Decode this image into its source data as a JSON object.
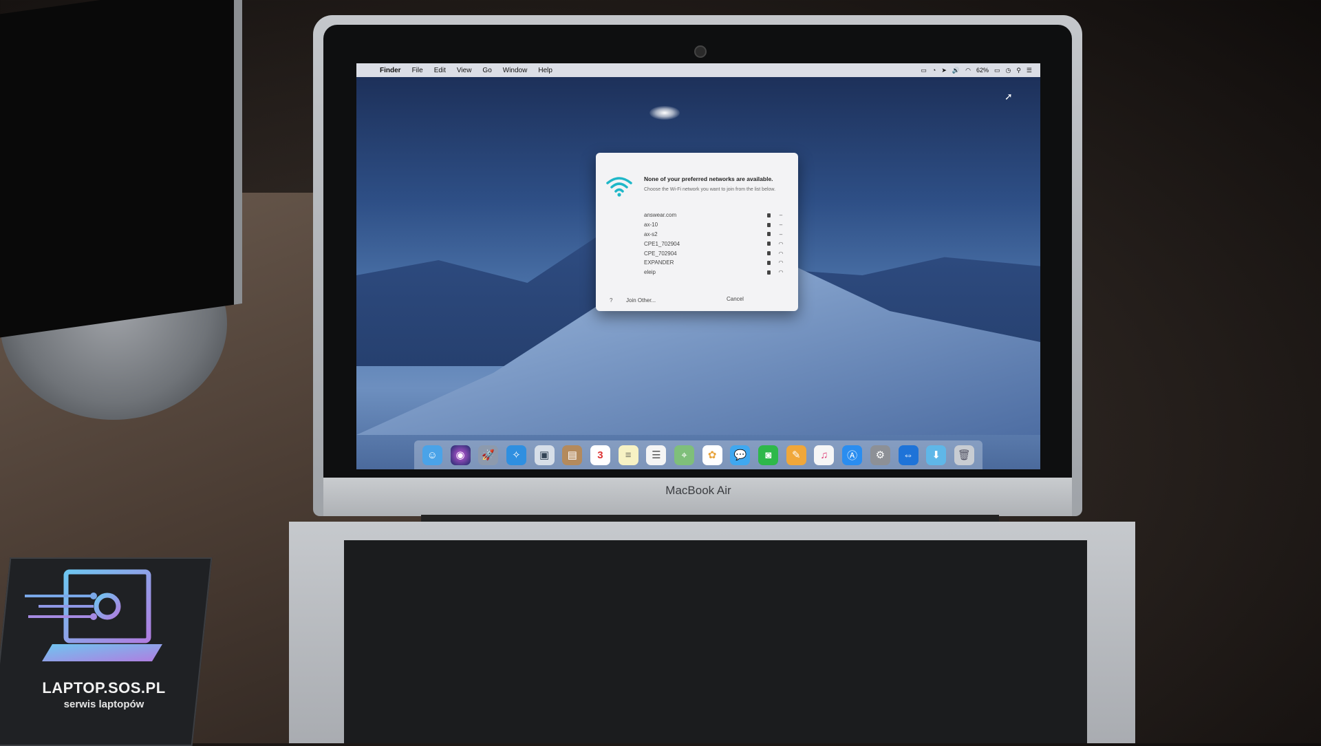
{
  "menubar": {
    "app_name": "Finder",
    "items": [
      "File",
      "Edit",
      "View",
      "Go",
      "Window",
      "Help"
    ],
    "battery_percent": "62%"
  },
  "dialog": {
    "title": "None of your preferred networks are available.",
    "subtitle": "Choose the Wi-Fi network you want to join from the list below.",
    "networks": [
      {
        "name": "answear.com",
        "locked": true,
        "signal": "weak"
      },
      {
        "name": "ax-10",
        "locked": true,
        "signal": "weak"
      },
      {
        "name": "ax-s2",
        "locked": true,
        "signal": "weak"
      },
      {
        "name": "CPE1_702904",
        "locked": true,
        "signal": "strong"
      },
      {
        "name": "CPE_702904",
        "locked": true,
        "signal": "strong"
      },
      {
        "name": "EXPANDER",
        "locked": true,
        "signal": "strong"
      },
      {
        "name": "eleip",
        "locked": true,
        "signal": "strong"
      }
    ],
    "help_label": "?",
    "join_other_label": "Join Other...",
    "cancel_label": "Cancel",
    "icon_color": "#1fb7c8"
  },
  "dock": {
    "icons": [
      "finder-icon",
      "siri-icon",
      "launchpad-icon",
      "safari-icon",
      "preview-icon",
      "contacts-icon",
      "calendar-icon",
      "notes-icon",
      "reminders-icon",
      "maps-icon",
      "photos-icon",
      "messages-icon",
      "facetime-icon",
      "pages-icon",
      "itunes-icon",
      "app-store-icon",
      "system-preferences-icon",
      "teamviewer-icon",
      "downloads-folder-icon",
      "trash-icon"
    ],
    "calendar_day": "3"
  },
  "laptop": {
    "brand": "MacBook Air"
  },
  "watermark": {
    "name": "LAPTOP.SOS.PL",
    "tagline": "serwis laptopów"
  }
}
